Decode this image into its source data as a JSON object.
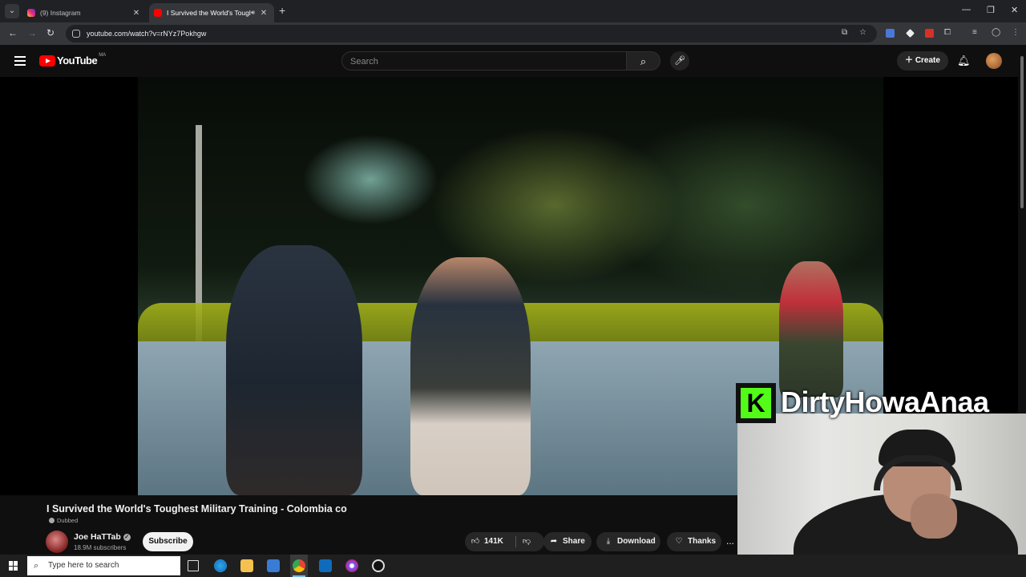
{
  "browser": {
    "tabs": [
      {
        "title": "(9) Instagram",
        "favicon": "instagram-icon",
        "active": false
      },
      {
        "title": "I Survived the World's Tougl",
        "favicon": "youtube-icon",
        "active": true,
        "audio": true
      }
    ],
    "address": "youtube.com/watch?v=rNYz7Pokhgw"
  },
  "youtube": {
    "logo_text": "YouTube",
    "country_code": "MA",
    "search_placeholder": "Search",
    "create_label": "Create"
  },
  "overlay": {
    "kick_letter": "K",
    "channel_name": "DirtyHowaAnaa"
  },
  "video": {
    "title": "I Survived the World's Toughest Military Training - Colombia co",
    "dubbed_label": "Dubbed",
    "channel": "Joe HaTTab",
    "subscribers": "18.9M subscribers",
    "subscribe_label": "Subscribe",
    "like_count": "141K",
    "share_label": "Share",
    "download_label": "Download",
    "thanks_label": "Thanks",
    "more_label": "..."
  },
  "taskbar": {
    "search_placeholder": "Type here to search"
  },
  "colors": {
    "youtube_red": "#ff0000",
    "kick_green": "#53fc18",
    "background": "#0f0f0f"
  }
}
